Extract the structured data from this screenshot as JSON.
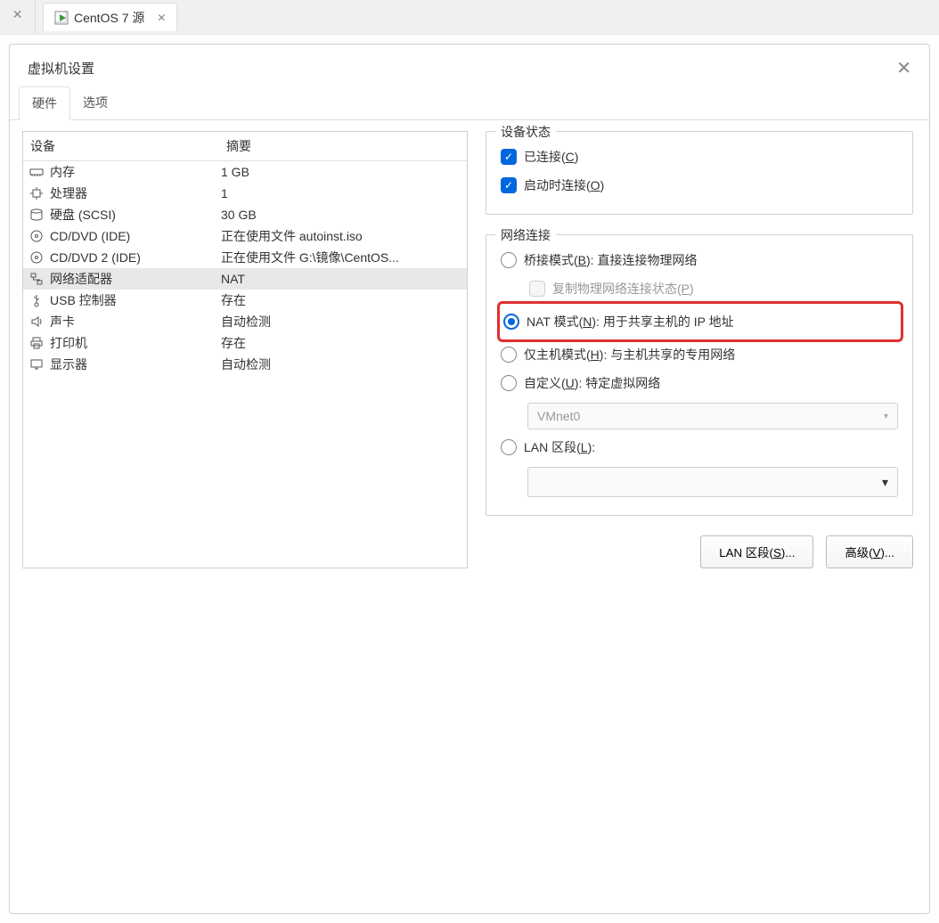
{
  "topbar": {
    "vm_tab_label": "CentOS 7 源"
  },
  "dialog": {
    "title": "虚拟机设置",
    "tabs": {
      "hardware": "硬件",
      "options": "选项"
    },
    "headers": {
      "device": "设备",
      "summary": "摘要"
    },
    "devices": [
      {
        "icon": "memory-icon",
        "name": "内存",
        "summary": "1 GB"
      },
      {
        "icon": "cpu-icon",
        "name": "处理器",
        "summary": "1"
      },
      {
        "icon": "disk-icon",
        "name": "硬盘 (SCSI)",
        "summary": "30 GB"
      },
      {
        "icon": "cd-icon",
        "name": "CD/DVD (IDE)",
        "summary": "正在使用文件 autoinst.iso"
      },
      {
        "icon": "cd-icon",
        "name": "CD/DVD 2 (IDE)",
        "summary": "正在使用文件 G:\\镜像\\CentOS..."
      },
      {
        "icon": "network-icon",
        "name": "网络适配器",
        "summary": "NAT"
      },
      {
        "icon": "usb-icon",
        "name": "USB 控制器",
        "summary": "存在"
      },
      {
        "icon": "sound-icon",
        "name": "声卡",
        "summary": "自动检测"
      },
      {
        "icon": "printer-icon",
        "name": "打印机",
        "summary": "存在"
      },
      {
        "icon": "display-icon",
        "name": "显示器",
        "summary": "自动检测"
      }
    ],
    "device_state": {
      "legend": "设备状态",
      "connected": {
        "label": "已连接(",
        "key": "C",
        "suffix": ")"
      },
      "connect_on_poweron": {
        "label": "启动时连接(",
        "key": "O",
        "suffix": ")"
      }
    },
    "network": {
      "legend": "网络连接",
      "bridged": {
        "label": "桥接模式(",
        "key": "B",
        "suffix": "): 直接连接物理网络"
      },
      "replicate": {
        "label": "复制物理网络连接状态(",
        "key": "P",
        "suffix": ")"
      },
      "nat": {
        "label": "NAT 模式(",
        "key": "N",
        "suffix": "): 用于共享主机的 IP 地址"
      },
      "hostonly": {
        "label": "仅主机模式(",
        "key": "H",
        "suffix": "): 与主机共享的专用网络"
      },
      "custom": {
        "label": "自定义(",
        "key": "U",
        "suffix": "): 特定虚拟网络"
      },
      "custom_value": "VMnet0",
      "lan": {
        "label": "LAN 区段(",
        "key": "L",
        "suffix": "):"
      }
    },
    "buttons": {
      "lan_segments": {
        "label": "LAN 区段(",
        "key": "S",
        "suffix": ")..."
      },
      "advanced": {
        "label": "高级(",
        "key": "V",
        "suffix": ")..."
      }
    }
  }
}
